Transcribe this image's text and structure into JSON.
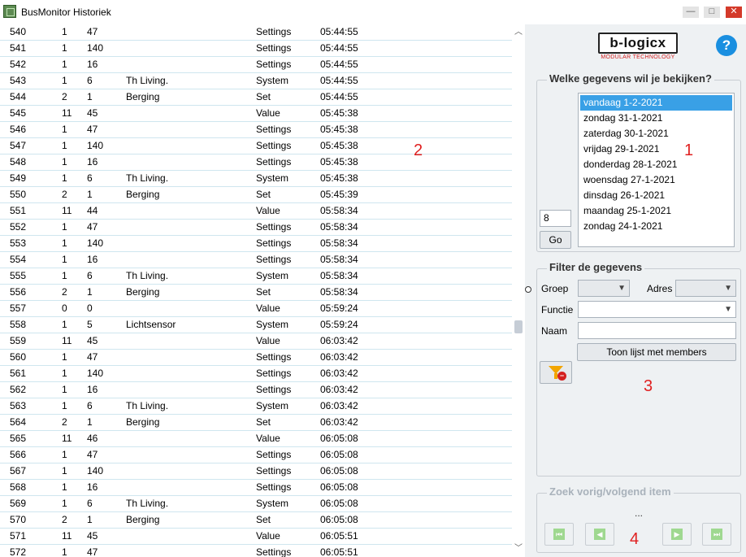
{
  "window": {
    "title": "BusMonitor Historiek",
    "minimize_glyph": "—",
    "maximize_glyph": "□",
    "close_glyph": "✕"
  },
  "table": {
    "rows": [
      [
        "540",
        "1",
        "47",
        "",
        "Settings",
        "05:44:55"
      ],
      [
        "541",
        "1",
        "140",
        "",
        "Settings",
        "05:44:55"
      ],
      [
        "542",
        "1",
        "16",
        "",
        "Settings",
        "05:44:55"
      ],
      [
        "543",
        "1",
        "6",
        "Th Living.",
        "System",
        "05:44:55"
      ],
      [
        "544",
        "2",
        "1",
        "Berging",
        "Set",
        "05:44:55"
      ],
      [
        "545",
        "11",
        "45",
        "",
        "Value",
        "05:45:38"
      ],
      [
        "546",
        "1",
        "47",
        "",
        "Settings",
        "05:45:38"
      ],
      [
        "547",
        "1",
        "140",
        "",
        "Settings",
        "05:45:38"
      ],
      [
        "548",
        "1",
        "16",
        "",
        "Settings",
        "05:45:38"
      ],
      [
        "549",
        "1",
        "6",
        "Th Living.",
        "System",
        "05:45:38"
      ],
      [
        "550",
        "2",
        "1",
        "Berging",
        "Set",
        "05:45:39"
      ],
      [
        "551",
        "11",
        "44",
        "",
        "Value",
        "05:58:34"
      ],
      [
        "552",
        "1",
        "47",
        "",
        "Settings",
        "05:58:34"
      ],
      [
        "553",
        "1",
        "140",
        "",
        "Settings",
        "05:58:34"
      ],
      [
        "554",
        "1",
        "16",
        "",
        "Settings",
        "05:58:34"
      ],
      [
        "555",
        "1",
        "6",
        "Th Living.",
        "System",
        "05:58:34"
      ],
      [
        "556",
        "2",
        "1",
        "Berging",
        "Set",
        "05:58:34"
      ],
      [
        "557",
        "0",
        "0",
        "",
        "Value",
        "05:59:24"
      ],
      [
        "558",
        "1",
        "5",
        "Lichtsensor",
        "System",
        "05:59:24"
      ],
      [
        "559",
        "11",
        "45",
        "",
        "Value",
        "06:03:42"
      ],
      [
        "560",
        "1",
        "47",
        "",
        "Settings",
        "06:03:42"
      ],
      [
        "561",
        "1",
        "140",
        "",
        "Settings",
        "06:03:42"
      ],
      [
        "562",
        "1",
        "16",
        "",
        "Settings",
        "06:03:42"
      ],
      [
        "563",
        "1",
        "6",
        "Th Living.",
        "System",
        "06:03:42"
      ],
      [
        "564",
        "2",
        "1",
        "Berging",
        "Set",
        "06:03:42"
      ],
      [
        "565",
        "11",
        "46",
        "",
        "Value",
        "06:05:08"
      ],
      [
        "566",
        "1",
        "47",
        "",
        "Settings",
        "06:05:08"
      ],
      [
        "567",
        "1",
        "140",
        "",
        "Settings",
        "06:05:08"
      ],
      [
        "568",
        "1",
        "16",
        "",
        "Settings",
        "06:05:08"
      ],
      [
        "569",
        "1",
        "6",
        "Th Living.",
        "System",
        "06:05:08"
      ],
      [
        "570",
        "2",
        "1",
        "Berging",
        "Set",
        "06:05:08"
      ],
      [
        "571",
        "11",
        "45",
        "",
        "Value",
        "06:05:51"
      ],
      [
        "572",
        "1",
        "47",
        "",
        "Settings",
        "06:05:51"
      ]
    ]
  },
  "annotations": {
    "one": "1",
    "two": "2",
    "three": "3",
    "four": "4"
  },
  "logo": {
    "text": "b-logicx",
    "subtext": "MODULAR TECHNOLOGY"
  },
  "help": {
    "glyph": "?"
  },
  "date_section": {
    "title": "Welke gegevens wil je bekijken?",
    "days_value": "8",
    "go_label": "Go",
    "dates": [
      "vandaag 1-2-2021",
      "zondag 31-1-2021",
      "zaterdag 30-1-2021",
      "vrijdag 29-1-2021",
      "donderdag 28-1-2021",
      "woensdag 27-1-2021",
      "dinsdag 26-1-2021",
      "maandag 25-1-2021",
      "zondag 24-1-2021"
    ],
    "selected_index": 0
  },
  "filter_section": {
    "title": "Filter de gegevens",
    "groep_label": "Groep",
    "adres_label": "Adres",
    "functie_label": "Functie",
    "naam_label": "Naam",
    "members_button": "Toon lijst met members",
    "groep_value": "",
    "adres_value": "",
    "functie_value": "",
    "naam_value": ""
  },
  "search_section": {
    "title": "Zoek vorig/volgend item",
    "status": "..."
  },
  "colors": {
    "selection": "#39a0e6",
    "annotation": "#e02020",
    "panel_bg": "#eef1f3",
    "nav_glyph": "#9fd890"
  }
}
